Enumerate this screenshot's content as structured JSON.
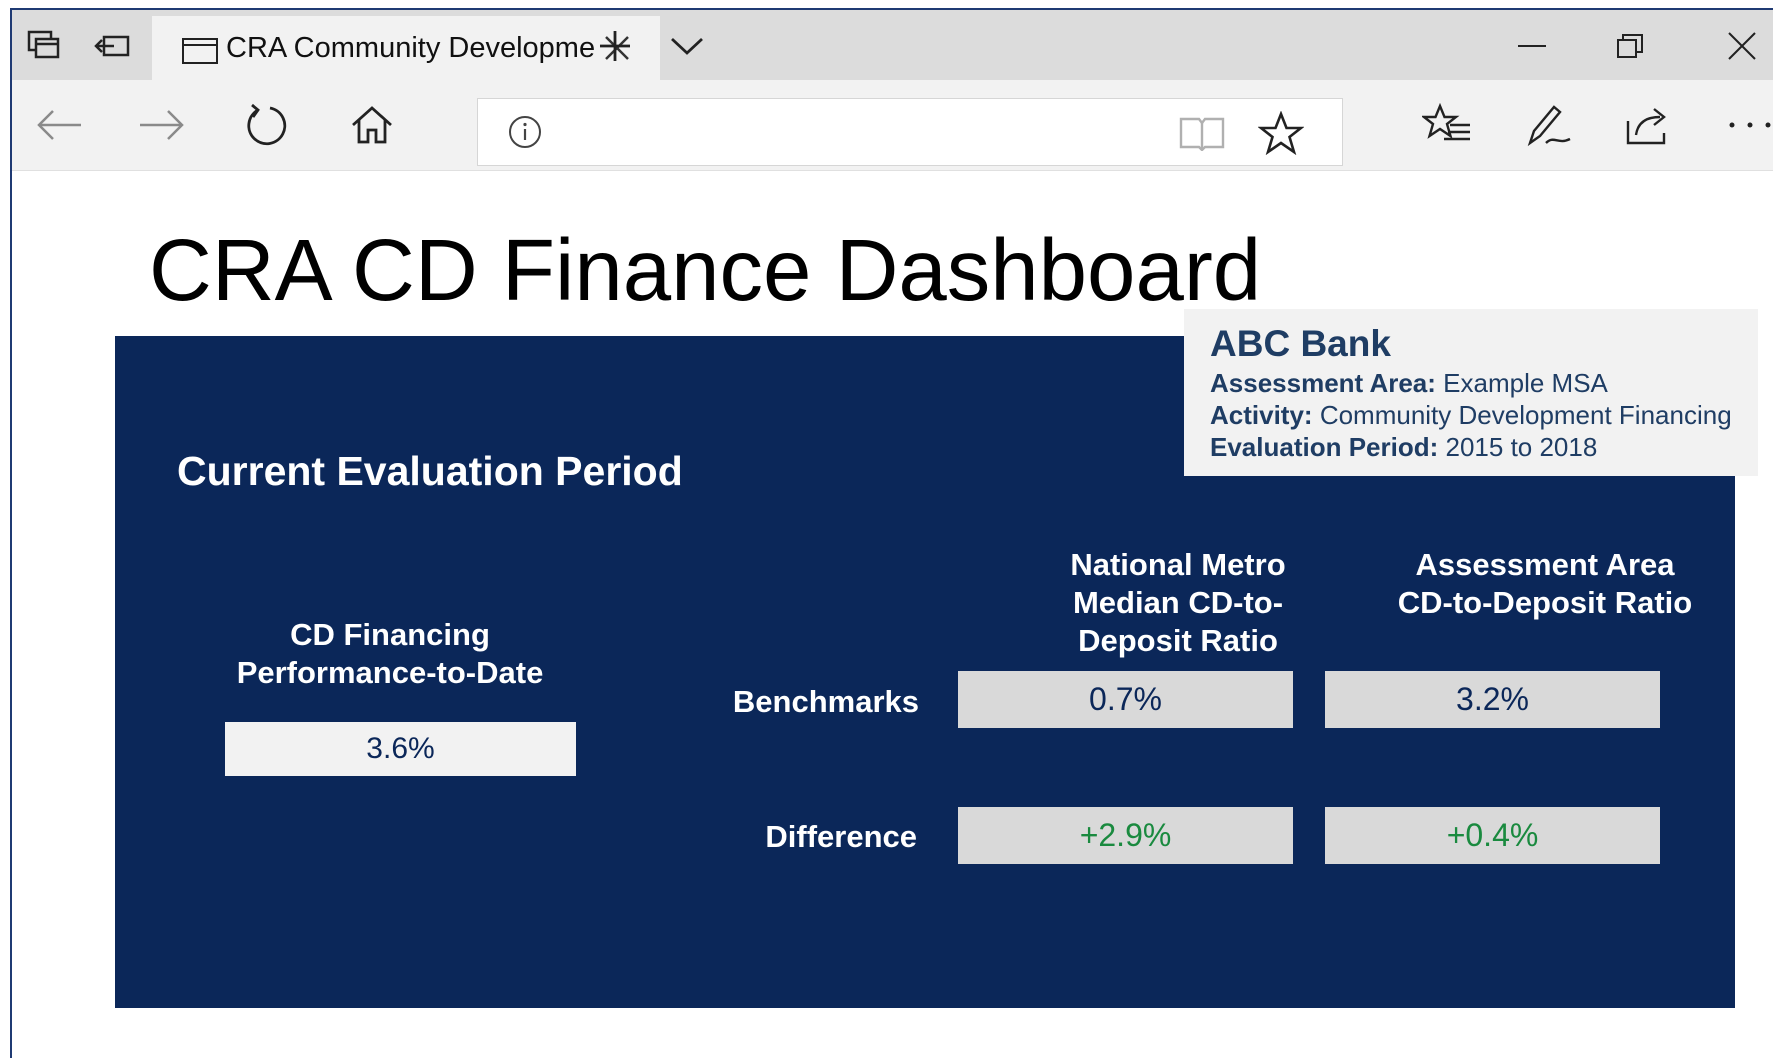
{
  "browser": {
    "tab_title": "CRA Community Developme",
    "address_value": ""
  },
  "page": {
    "title": "CRA CD Finance Dashboard"
  },
  "info": {
    "bank_name": "ABC Bank",
    "assessment_area_label": "Assessment Area:",
    "assessment_area_value": "Example MSA",
    "activity_label": "Activity:",
    "activity_value": "Community Development Financing",
    "evaluation_period_label": "Evaluation Period:",
    "evaluation_period_value": "2015 to 2018"
  },
  "panel": {
    "section_title": "Current Evaluation Period",
    "performance_label_line1": "CD Financing",
    "performance_label_line2": "Performance-to-Date",
    "performance_value": "3.6%",
    "columns": [
      {
        "line1": "National Metro",
        "line2": "Median CD-to-",
        "line3": "Deposit Ratio"
      },
      {
        "line1": "Assessment Area",
        "line2": "CD-to-Deposit Ratio",
        "line3": ""
      }
    ],
    "rows": {
      "benchmarks_label": "Benchmarks",
      "difference_label": "Difference"
    },
    "benchmarks": [
      "0.7%",
      "3.2%"
    ],
    "differences": [
      "+2.9%",
      "+0.4%"
    ]
  },
  "colors": {
    "panel_bg": "#0b2759",
    "positive_diff": "#1a8a3f",
    "info_text": "#1f3d64"
  }
}
